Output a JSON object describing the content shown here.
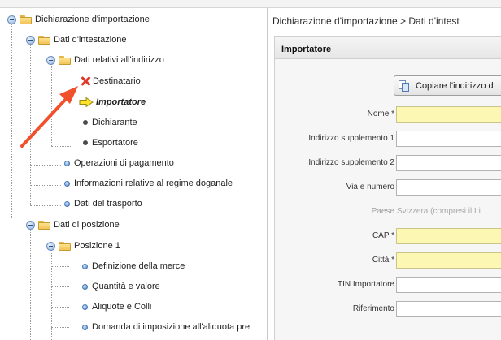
{
  "tree": {
    "root": "Dichiarazione d'importazione",
    "header_group": "Dati d'intestazione",
    "address_group": "Dati relativi all'indirizzo",
    "recipient": "Destinatario",
    "importer": "Importatore",
    "declarant": "Dichiarante",
    "exporter": "Esportatore",
    "payment": "Operazioni di pagamento",
    "customs_regime": "Informazioni relative al regime doganale",
    "transport": "Dati del trasporto",
    "position_data": "Dati di posizione",
    "position1": "Posizione 1",
    "goods_definition": "Definizione della merce",
    "quantity_value": "Quantità e valore",
    "rates_packages": "Aliquote e Colli",
    "tax_request": "Domanda di imposizione all'aliquota pre"
  },
  "main": {
    "breadcrumb": "Dichiarazione d'importazione > Dati d'intest",
    "panel_title": "Importatore",
    "copy_button": "Copiare l'indirizzo d",
    "fields": {
      "name": "Nome *",
      "address_suppl1": "Indirizzo supplemento 1",
      "address_suppl2": "Indirizzo supplemento 2",
      "street": "Via e numero",
      "country": "Paese",
      "country_value": "Svizzera (compresi il Li",
      "zip": "CAP *",
      "city": "Città *",
      "tin": "TIN Importatore",
      "reference": "Riferimento"
    }
  },
  "colors": {
    "required_field": "#fcf8b4",
    "pointer_arrow": "#f0502a",
    "error_x": "#e0392b",
    "current_arrow": "#ffe22b"
  }
}
